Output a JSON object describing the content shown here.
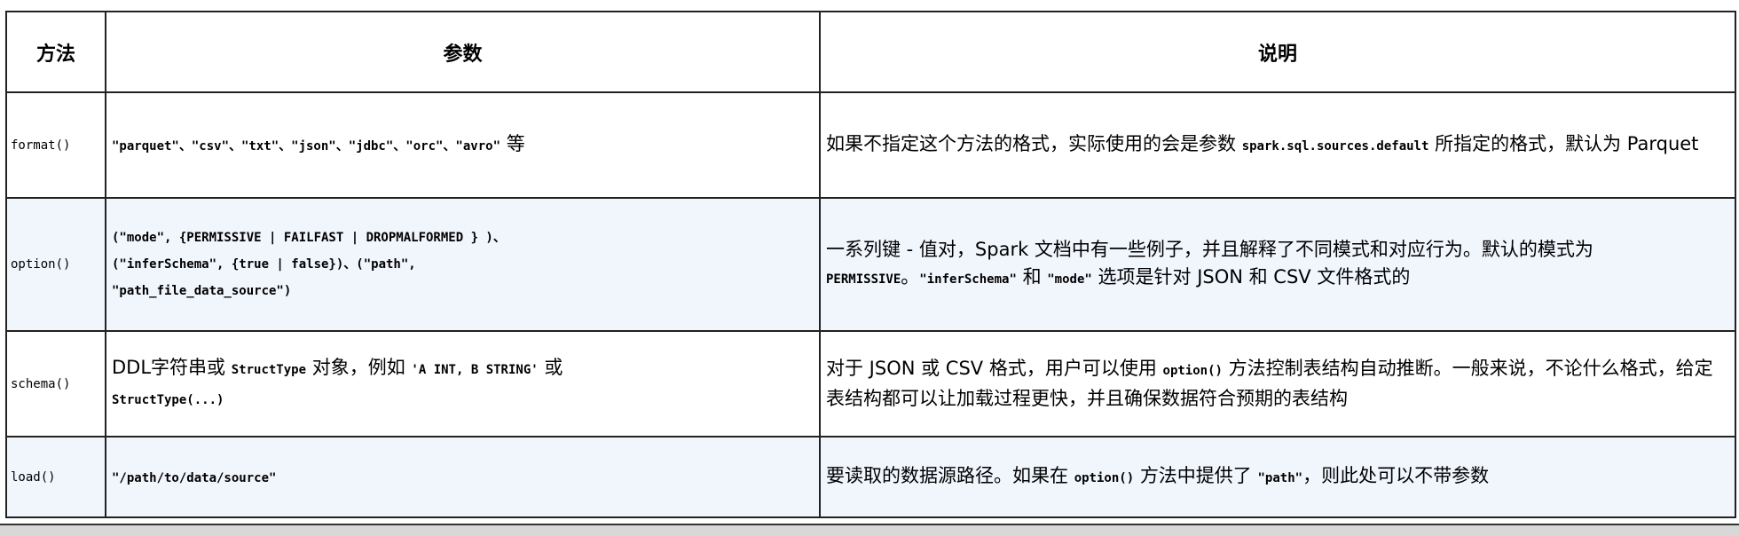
{
  "header": {
    "col_method": "方法",
    "col_params": "参数",
    "col_desc": "说明"
  },
  "rows": [
    {
      "method": "format()",
      "params": {
        "code": "\"parquet\"、\"csv\"、\"txt\"、\"json\"、\"jdbc\"、\"orc\"、\"avro\"",
        "suffix": "等"
      },
      "desc": {
        "t1": "如果不指定这个方法的格式，实际使用的会是参数",
        "code1": "spark.sql.sources.default",
        "t2": "所指定的格式，默认为 Parquet"
      }
    },
    {
      "method": "option()",
      "params": {
        "line1": "(\"mode\", {PERMISSIVE | FAILFAST | DROPMALFORMED } )、",
        "line2": "(\"inferSchema\", {true | false})、(\"path\",",
        "line3": "\"path_file_data_source\")"
      },
      "desc": {
        "t1": "一系列键 - 值对，Spark 文档中有一些例子，并且解释了不同模式和对应行为。默认的模式为",
        "code1": "PERMISSIVE",
        "t2": "。",
        "code2": "\"inferSchema\"",
        "t3": "和",
        "code3": "\"mode\"",
        "t4": "选项是针对 JSON 和 CSV 文件格式的"
      }
    },
    {
      "method": "schema()",
      "params": {
        "t1": "DDL字符串或",
        "code1": "StructType",
        "t2": "对象，例如",
        "code2": "'A INT, B STRING'",
        "t3": "或",
        "code3": "StructType(...)"
      },
      "desc": {
        "t1": "对于 JSON 或 CSV 格式，用户可以使用",
        "code1": "option()",
        "t2": "方法控制表结构自动推断。一般来说，不论什么格式，给定表结构都可以让加载过程更快，并且确保数据符合预期的表结构"
      }
    },
    {
      "method": "load()",
      "params": {
        "code": "\"/path/to/data/source\""
      },
      "desc": {
        "t1": "要读取的数据源路径。如果在",
        "code1": "option()",
        "t2": "方法中提供了",
        "code2": "\"path\"",
        "t3": "，则此处可以不带参数"
      }
    }
  ]
}
